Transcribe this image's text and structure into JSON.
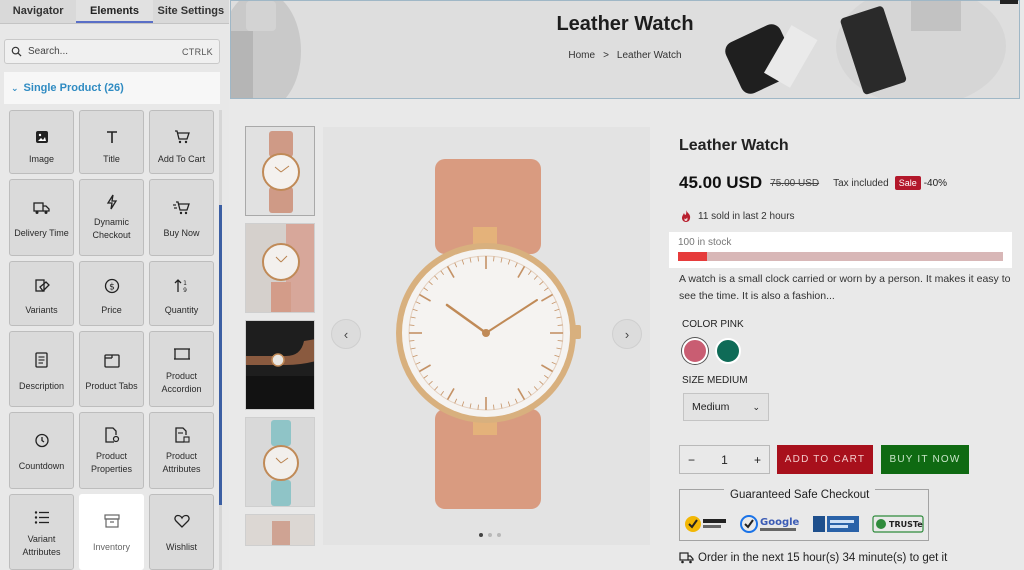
{
  "sidebar": {
    "tabs": [
      "Navigator",
      "Elements",
      "Site Settings"
    ],
    "search": {
      "placeholder": "Search...",
      "shortcut": "CTRLK"
    },
    "section": "Single Product (26)",
    "widgets": [
      {
        "label": "Image",
        "icon": "image-icon"
      },
      {
        "label": "Title",
        "icon": "title-icon"
      },
      {
        "label": "Add To Cart",
        "icon": "cart-icon"
      },
      {
        "label": "Delivery Time",
        "icon": "truck-icon"
      },
      {
        "label": "Dynamic Checkout",
        "icon": "lightning-icon"
      },
      {
        "label": "Buy Now",
        "icon": "cart-fast-icon"
      },
      {
        "label": "Variants",
        "icon": "variants-icon"
      },
      {
        "label": "Price",
        "icon": "dollar-icon"
      },
      {
        "label": "Quantity",
        "icon": "sort-numbers-icon"
      },
      {
        "label": "Description",
        "icon": "document-icon"
      },
      {
        "label": "Product Tabs",
        "icon": "tabs-icon"
      },
      {
        "label": "Product Accordion",
        "icon": "accordion-icon"
      },
      {
        "label": "Countdown",
        "icon": "clock-icon"
      },
      {
        "label": "Product Properties",
        "icon": "properties-icon"
      },
      {
        "label": "Product Attributes",
        "icon": "attributes-icon"
      },
      {
        "label": "Variant Attributes",
        "icon": "list-icon"
      },
      {
        "label": "Inventory",
        "icon": "archive-icon"
      },
      {
        "label": "Wishlist",
        "icon": "heart-icon"
      }
    ]
  },
  "preview": {
    "hero": {
      "title": "Leather Watch",
      "breadcrumb_home": "Home",
      "breadcrumb_sep": ">",
      "breadcrumb_current": "Leather Watch"
    },
    "product": {
      "title": "Leather Watch",
      "price": "45.00 USD",
      "old_price": "75.00 USD",
      "tax": "Tax included",
      "sale": "Sale",
      "discount": "-40%",
      "sold": "11 sold in last 2 hours",
      "stock": "100 in stock",
      "stock_level": 0.09,
      "description": "A watch is a small clock carried or worn by a person. It makes it easy to see the time. It is also a fashion...",
      "color_label": "COLOR PINK",
      "colors": [
        "#c95d72",
        "#0f6b57"
      ],
      "size_label": "SIZE MEDIUM",
      "size_value": "Medium",
      "quantity": "1",
      "qty_minus": "−",
      "qty_plus": "+",
      "add_to_cart": "ADD TO CART",
      "buy_now": "BUY IT NOW",
      "guarantee": "Guaranteed Safe Checkout",
      "order_note": "Order in the next 15 hour(s) 34 minute(s) to get it"
    },
    "slider": {
      "prev": "‹",
      "next": "›"
    }
  }
}
